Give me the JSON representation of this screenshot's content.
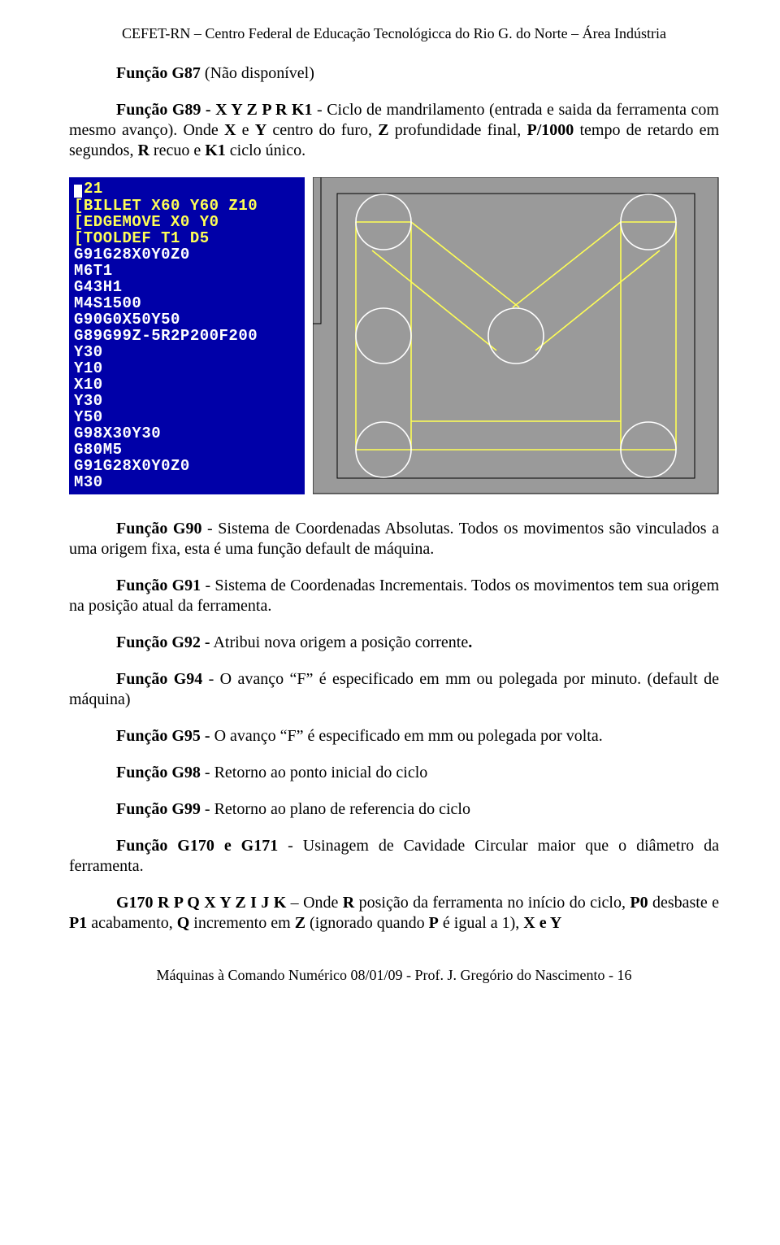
{
  "header": "CEFET-RN – Centro Federal de Educação Tecnológicca do Rio G. do Norte – Área Indústria",
  "p1a": "Função G87",
  "p1b": "   (Não disponível)",
  "p2a": "Função G89 - X Y Z P R K1",
  "p2b": " - Ciclo de mandrilamento (entrada e saida da ferramenta com mesmo avanço). Onde ",
  "p2c": "X",
  "p2d": " e ",
  "p2e": "Y",
  "p2f": " centro do furo, ",
  "p2g": "Z",
  "p2h": " profundidade final, ",
  "p2i": "P/1000",
  "p2j": " tempo de  retardo em segundos, ",
  "p2k": "R",
  "p2l": " recuo e ",
  "p2m": "K1",
  "p2n": "  ciclo  único.",
  "code": [
    {
      "c": "cursor",
      "t": "21"
    },
    {
      "c": "y",
      "t": "[BILLET X60 Y60 Z10"
    },
    {
      "c": "y",
      "t": "[EDGEMOVE X0 Y0"
    },
    {
      "c": "y",
      "t": "[TOOLDEF T1 D5"
    },
    {
      "c": "w",
      "t": "G91G28X0Y0Z0"
    },
    {
      "c": "w",
      "t": "M6T1"
    },
    {
      "c": "w",
      "t": "G43H1"
    },
    {
      "c": "w",
      "t": "M4S1500"
    },
    {
      "c": "w",
      "t": "G90G0X50Y50"
    },
    {
      "c": "w",
      "t": "G89G99Z-5R2P200F200"
    },
    {
      "c": "w",
      "t": "Y30"
    },
    {
      "c": "w",
      "t": "Y10"
    },
    {
      "c": "w",
      "t": "X10"
    },
    {
      "c": "w",
      "t": "Y30"
    },
    {
      "c": "w",
      "t": "Y50"
    },
    {
      "c": "w",
      "t": "G98X30Y30"
    },
    {
      "c": "w",
      "t": "G80M5"
    },
    {
      "c": "w",
      "t": "G91G28X0Y0Z0"
    },
    {
      "c": "w",
      "t": "M30"
    }
  ],
  "p3a": "Função G90",
  "p3b": " - Sistema de Coordenadas Absolutas. Todos os movimentos são vinculados a uma  origem fixa, esta é uma função default de máquina.",
  "p4a": "Função G91",
  "p4b": " - Sistema de  Coordenadas  Incrementais. Todos  os movimentos tem sua origem na  posição atual da ferramenta.",
  "p5a": "Função G92 -",
  "p5b": " Atribui nova  origem a posição  corrente",
  "p5c": ".",
  "p6a": "Função G94",
  "p6b": "  -   O avanço “F” é especificado em mm ou polegada por minuto. (default de máquina)",
  "p7a": "Função G95 - ",
  "p7b": "O  avanço “F” é especificado em  mm ou polegada por volta.",
  "p8a": "Função G98",
  "p8b": " - Retorno ao ponto inicial do  ciclo",
  "p9a": "Função G99",
  "p9b": " -  Retorno ao plano de referencia do ciclo",
  "p10a": "Função G170 e G171",
  "p10b": " - Usinagem de Cavidade Circular maior que o diâmetro da ferramenta.",
  "p11a": "G170 R P Q X Y Z I J K",
  "p11b": " – Onde ",
  "p11c": "R",
  "p11d": " posição da ferramenta no início do ciclo, ",
  "p11e": "P0",
  "p11f": " desbaste e ",
  "p11g": "P1",
  "p11h": " acabamento, ",
  "p11i": "Q",
  "p11j": " incremento em ",
  "p11k": "Z",
  "p11l": " (ignorado quando ",
  "p11m": "P",
  "p11n": " é igual a 1), ",
  "p11o": "X e  Y",
  "footer": "Máquinas à Comando Numérico 08/01/09 -  Prof. J. Gregório do  Nascimento - 16"
}
